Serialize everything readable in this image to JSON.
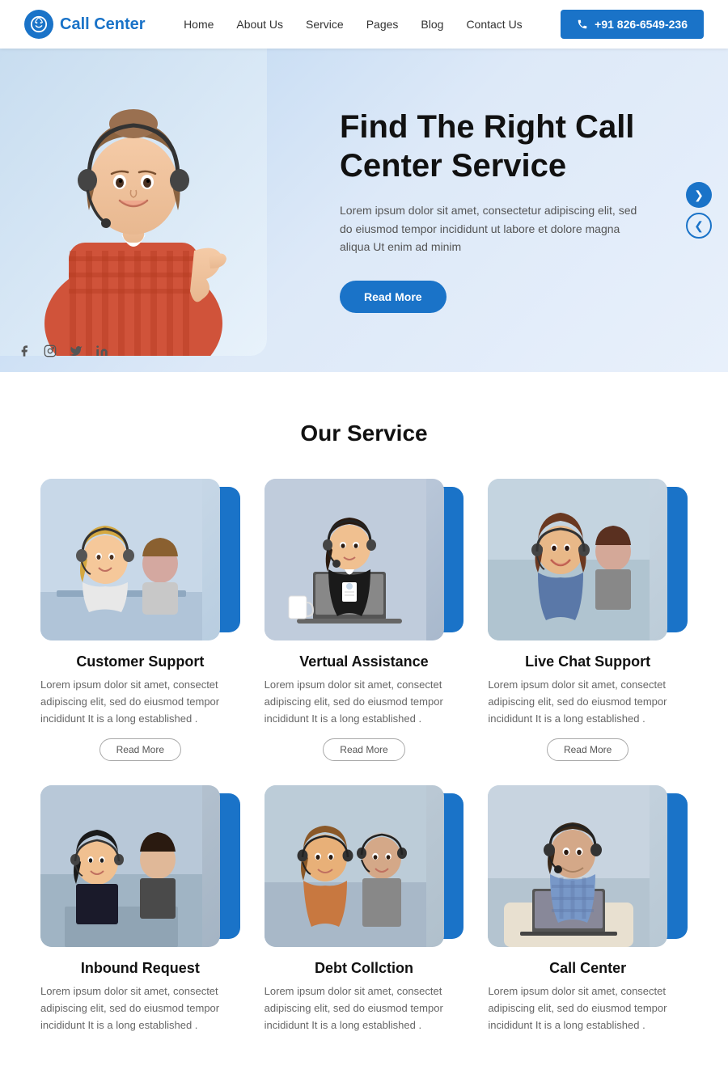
{
  "header": {
    "logo_text": "Call Center",
    "phone": "+91 826-6549-236",
    "nav": [
      {
        "label": "Home",
        "id": "home"
      },
      {
        "label": "About Us",
        "id": "about"
      },
      {
        "label": "Service",
        "id": "service"
      },
      {
        "label": "Pages",
        "id": "pages"
      },
      {
        "label": "Blog",
        "id": "blog"
      },
      {
        "label": "Contact Us",
        "id": "contact"
      }
    ]
  },
  "hero": {
    "title": "Find The Right Call Center Service",
    "description": "Lorem ipsum dolor sit amet, consectetur adipiscing elit, sed do eiusmod tempor incididunt ut labore et dolore magna aliqua Ut enim ad minim",
    "read_more": "Read More",
    "social": [
      "f",
      "in",
      "tw",
      "li"
    ]
  },
  "services": {
    "section_title": "Our Service",
    "items": [
      {
        "title": "Customer Support",
        "desc": "Lorem ipsum dolor sit amet, consectet adipiscing elit, sed do eiusmod tempor incididunt It is a long established .",
        "read_more": "Read More"
      },
      {
        "title": "Vertual Assistance",
        "desc": "Lorem ipsum dolor sit amet, consectet adipiscing elit, sed do eiusmod tempor incididunt It is a long established .",
        "read_more": "Read More"
      },
      {
        "title": "Live Chat Support",
        "desc": "Lorem ipsum dolor sit amet, consectet adipiscing elit, sed do eiusmod tempor incididunt It is a long established .",
        "read_more": "Read More"
      },
      {
        "title": "Inbound Request",
        "desc": "Lorem ipsum dolor sit amet, consectet adipiscing elit, sed do eiusmod tempor incididunt It is a long established .",
        "read_more": "Read More"
      },
      {
        "title": "Debt Collction",
        "desc": "Lorem ipsum dolor sit amet, consectet adipiscing elit, sed do eiusmod tempor incididunt It is a long established .",
        "read_more": "Read More"
      },
      {
        "title": "Call Center",
        "desc": "Lorem ipsum dolor sit amet, consectet adipiscing elit, sed do eiusmod tempor incididunt It is a long established .",
        "read_more": "Read More"
      }
    ]
  }
}
